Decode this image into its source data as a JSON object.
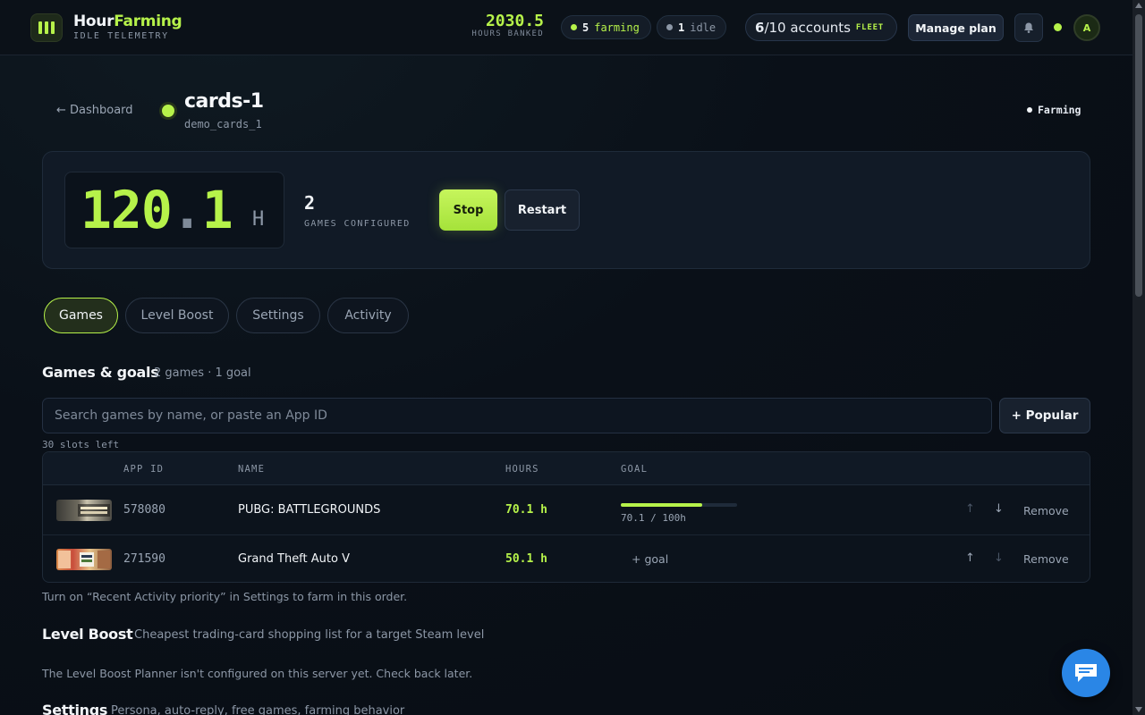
{
  "brand": {
    "name_a": "Hour",
    "name_b": "Farming",
    "subtitle": "IDLE TELEMETRY"
  },
  "topbar": {
    "hours_banked_value": "2030.5",
    "hours_banked_label": "HOURS BANKED",
    "farming_count": "5",
    "farming_label": "farming",
    "idle_count": "1",
    "idle_label": "idle",
    "accounts_used": "6",
    "accounts_total": "/10 accounts",
    "fleet_label": "FLEET",
    "manage_plan": "Manage plan",
    "avatar_initial": "A"
  },
  "account": {
    "back_label": "← Dashboard",
    "name": "cards-1",
    "username": "demo_cards_1",
    "state": "Farming"
  },
  "stats": {
    "hours_int": "120",
    "hours_dot": ".",
    "hours_dec": "1",
    "hours_unit": "H",
    "games_configured": "2",
    "games_configured_label": "GAMES CONFIGURED",
    "stop_label": "Stop",
    "restart_label": "Restart"
  },
  "tabs": [
    {
      "label": "Games",
      "active": true
    },
    {
      "label": "Level Boost",
      "active": false
    },
    {
      "label": "Settings",
      "active": false
    },
    {
      "label": "Activity",
      "active": false
    }
  ],
  "games_section": {
    "title": "Games & goals",
    "subtitle": "2 games · 1 goal",
    "search_placeholder": "Search games by name, or paste an App ID",
    "popular_label": "+ Popular",
    "slots_left": "30 slots left",
    "columns": [
      "APP ID",
      "NAME",
      "HOURS",
      "GOAL"
    ],
    "rows": [
      {
        "app_id": "578080",
        "name": "PUBG: BATTLEGROUNDS",
        "hours": "70.1 h",
        "goal_text": "70.1 / 100h",
        "goal_progress": 0.701,
        "remove": "Remove",
        "up_enabled": false,
        "down_enabled": true
      },
      {
        "app_id": "271590",
        "name": "Grand Theft Auto V",
        "hours": "50.1 h",
        "goal_text": "+ goal",
        "goal_progress": null,
        "remove": "Remove",
        "up_enabled": true,
        "down_enabled": false
      }
    ],
    "note": "Turn on “Recent Activity priority” in Settings to farm in this order."
  },
  "level_boost": {
    "title": "Level Boost",
    "subtitle": "Cheapest trading-card shopping list for a target Steam level",
    "message": "The Level Boost Planner isn't configured on this server yet. Check back later."
  },
  "settings_section": {
    "title": "Settings",
    "subtitle": "Persona, auto-reply, free games, farming behavior"
  },
  "colors": {
    "accent": "#b6f24a",
    "background": "#0a1018",
    "chat": "#2a86e6"
  }
}
